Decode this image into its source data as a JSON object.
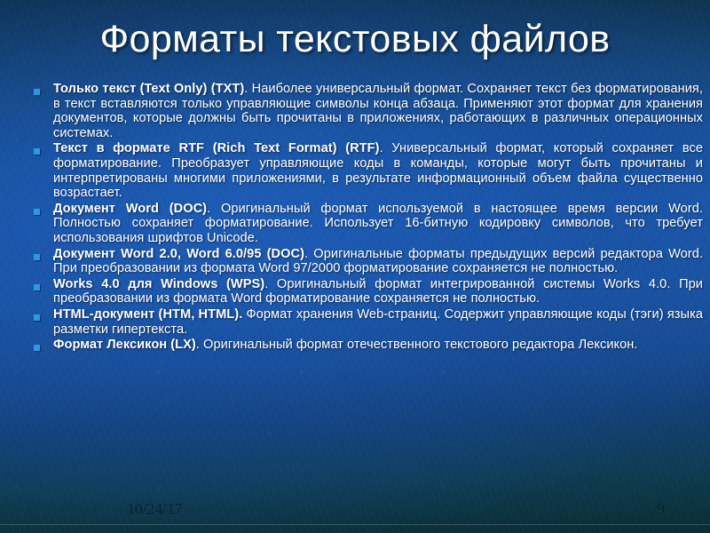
{
  "slide": {
    "title": "Форматы текстовых файлов",
    "bullet_marker_color": "#2b9ae4",
    "title_color": "#ffffff",
    "body_color": "#ffffff",
    "background_colors": [
      "#0d2d45",
      "#1a57ab",
      "#0a2c36"
    ],
    "bullets": [
      {
        "marker": "square-bullet-icon",
        "term": "Только текст (Text Only) (TXT)",
        "body": ". Наиболее универсальный формат. Сохраняет текст без форматирования, в текст вставляются только управляющие символы конца абзаца. Применяют этот формат для хранения документов, которые должны быть прочитаны в приложениях, работающих в различных операционных системах."
      },
      {
        "marker": "square-bullet-icon",
        "term": "Текст в формате RTF (Rich Text Format) (RTF)",
        "body": ". Универсальный формат, который сохраняет все форматирование. Преобразует управляющие коды в команды, которые могут быть прочитаны и интерпретированы многими приложениями, в результате информационный объем файла существенно возрастает."
      },
      {
        "marker": "square-bullet-icon",
        "term": "Документ Word (DOC)",
        "body": ". Оригинальный формат используемой в настоящее время версии Word. Полностью сохраняет форматирование. Использует 16-битную кодировку символов, что требует использования шрифтов Unicode."
      },
      {
        "marker": "square-bullet-icon",
        "term": "Документ Word 2.0, Word 6.0/95 (DOC)",
        "body": ". Оригинальные форматы предыдущих версий редактора Word. При преобразовании из формата Word 97/2000 форматирование сохраняется не полностью."
      },
      {
        "marker": "square-bullet-icon",
        "term": "Works 4.0 для Windows (WPS)",
        "body": ". Оригинальный формат интегрированной системы Works 4.0. При преобразовании из формата Word форматирование сохраняется не полностью."
      },
      {
        "marker": "square-bullet-icon",
        "term": "HTML-документ (HTM, HTML).",
        "body": " Формат хранения Web-страниц. Содержит управляющие коды (тэги) языка разметки гипертекста."
      },
      {
        "marker": "square-bullet-icon",
        "term": "Формат Лексикон (LX)",
        "body": ". Оригинальный формат отечественного текстового редактора Лексикон."
      }
    ]
  },
  "footer": {
    "date": "10/24/17",
    "page_number": "9"
  }
}
